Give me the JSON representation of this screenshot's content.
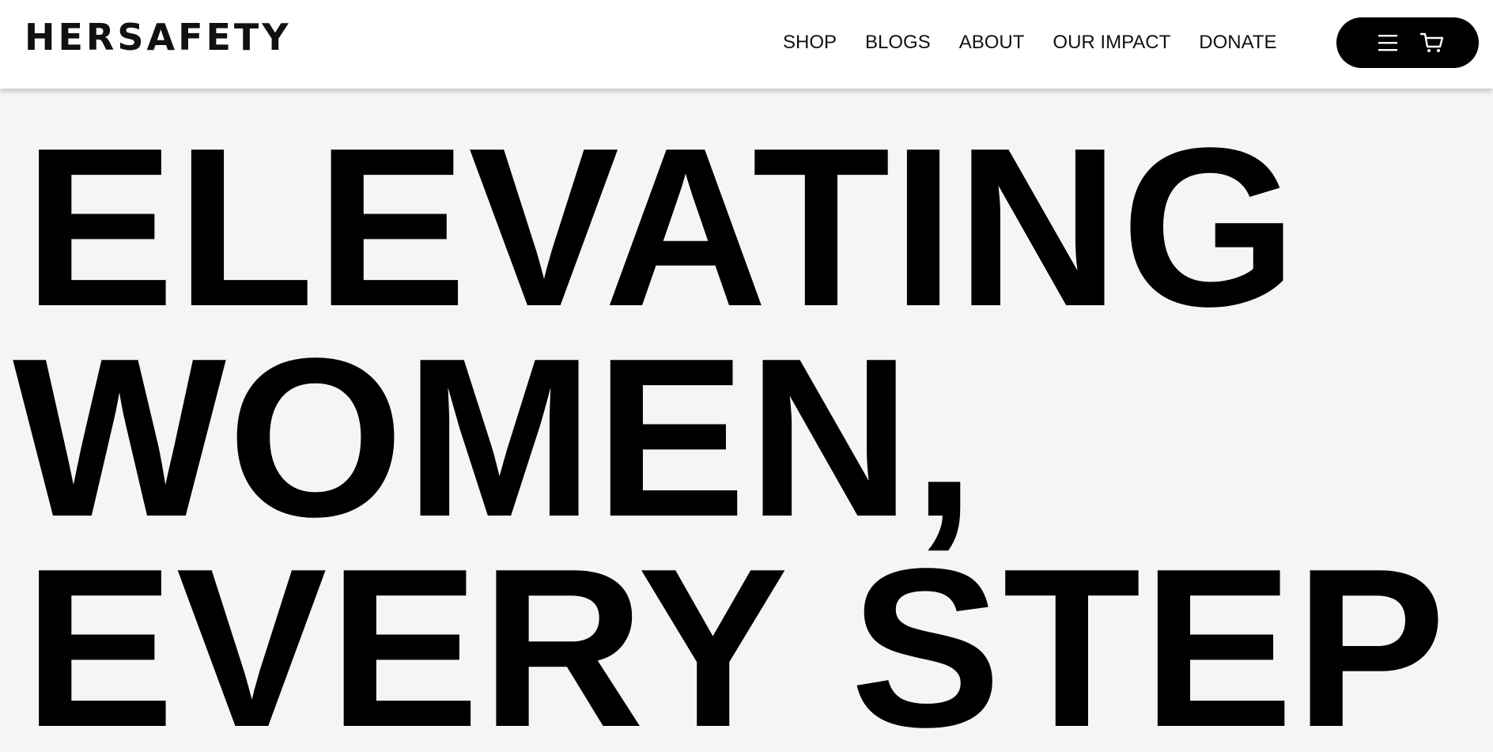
{
  "header": {
    "logo": "HERSAFETY",
    "nav": [
      {
        "label": "SHOP"
      },
      {
        "label": "BLOGS"
      },
      {
        "label": "ABOUT"
      },
      {
        "label": "OUR IMPACT"
      },
      {
        "label": "DONATE"
      }
    ],
    "actions": {
      "menu_icon": "hamburger-menu-icon",
      "cart_icon": "shopping-cart-icon"
    }
  },
  "hero": {
    "lines": [
      "ELEVATING",
      "WOMEN,",
      "EVERY STEP"
    ]
  },
  "colors": {
    "header_bg": "#ffffff",
    "page_bg": "#f5f5f5",
    "text": "#000000",
    "pill_bg": "#000000",
    "pill_icon": "#ffffff"
  }
}
